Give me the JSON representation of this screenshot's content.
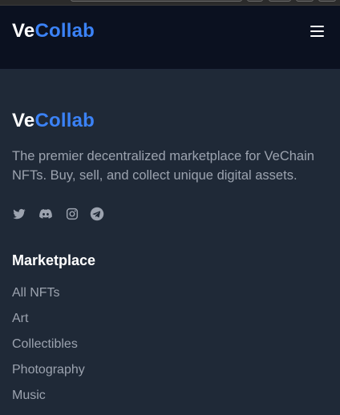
{
  "header": {
    "logo_ve": "Ve",
    "logo_collab": "Collab"
  },
  "footer": {
    "logo_ve": "Ve",
    "logo_collab": "Collab",
    "description": "The premier decentralized marketplace for VeChain NFTs. Buy, sell, and collect unique digital assets.",
    "socials": [
      "twitter-icon",
      "discord-icon",
      "instagram-icon",
      "telegram-icon"
    ],
    "marketplace": {
      "title": "Marketplace",
      "links": [
        "All NFTs",
        "Art",
        "Collectibles",
        "Photography",
        "Music"
      ]
    }
  },
  "colors": {
    "accent": "#3b82f6",
    "header_bg": "#0b1120",
    "footer_bg": "#1f2937",
    "muted_text": "#9ca3af"
  }
}
